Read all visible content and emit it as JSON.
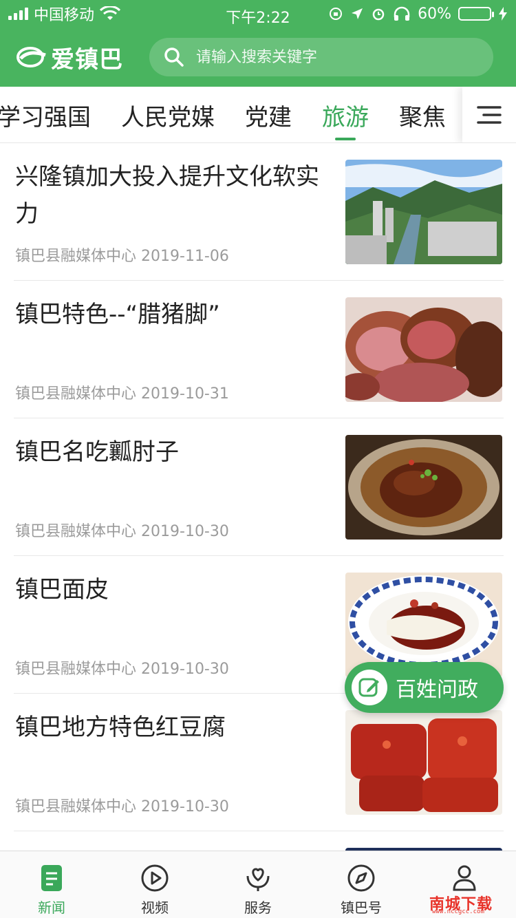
{
  "status_bar": {
    "carrier": "中国移动",
    "time": "下午2:22",
    "battery": "60%",
    "battery_level": 0.6
  },
  "app": {
    "name": "爱镇巴",
    "search_placeholder": "请输入搜索关键字",
    "brand_color": "#49b45f"
  },
  "tabs": [
    {
      "label": "学习强国",
      "active": false
    },
    {
      "label": "人民党媒",
      "active": false
    },
    {
      "label": "党建",
      "active": false
    },
    {
      "label": "旅游",
      "active": true
    },
    {
      "label": "聚焦",
      "active": false
    }
  ],
  "news": [
    {
      "title": "兴隆镇加大投入提升文化软实力",
      "source": "镇巴县融媒体中心",
      "date": "2019-11-06",
      "image": "town-river-aerial-photo"
    },
    {
      "title": "镇巴特色--“腊猪脚”",
      "source": "镇巴县融媒体中心",
      "date": "2019-10-31",
      "image": "cured-pork-leg-photo"
    },
    {
      "title": "镇巴名吃瓤肘子",
      "source": "镇巴县融媒体中心",
      "date": "2019-10-30",
      "image": "braised-pork-photo"
    },
    {
      "title": "镇巴面皮",
      "source": "镇巴县融媒体中心",
      "date": "2019-10-30",
      "image": "liangpi-noodles-photo"
    },
    {
      "title": "镇巴地方特色红豆腐",
      "source": "镇巴县融媒体中心",
      "date": "2019-10-30",
      "image": "red-tofu-photo"
    }
  ],
  "fab": {
    "label": "百姓问政",
    "icon": "edit-icon"
  },
  "bottom_nav": [
    {
      "label": "新闻",
      "icon": "news-icon",
      "active": true
    },
    {
      "label": "视频",
      "icon": "play-icon",
      "active": false
    },
    {
      "label": "服务",
      "icon": "service-heart-icon",
      "active": false
    },
    {
      "label": "镇巴号",
      "icon": "compass-icon",
      "active": false
    },
    {
      "label": "",
      "icon": "user-icon",
      "active": false
    }
  ],
  "watermark": {
    "text": "南城下载",
    "url": "www.nccgcc.com"
  }
}
